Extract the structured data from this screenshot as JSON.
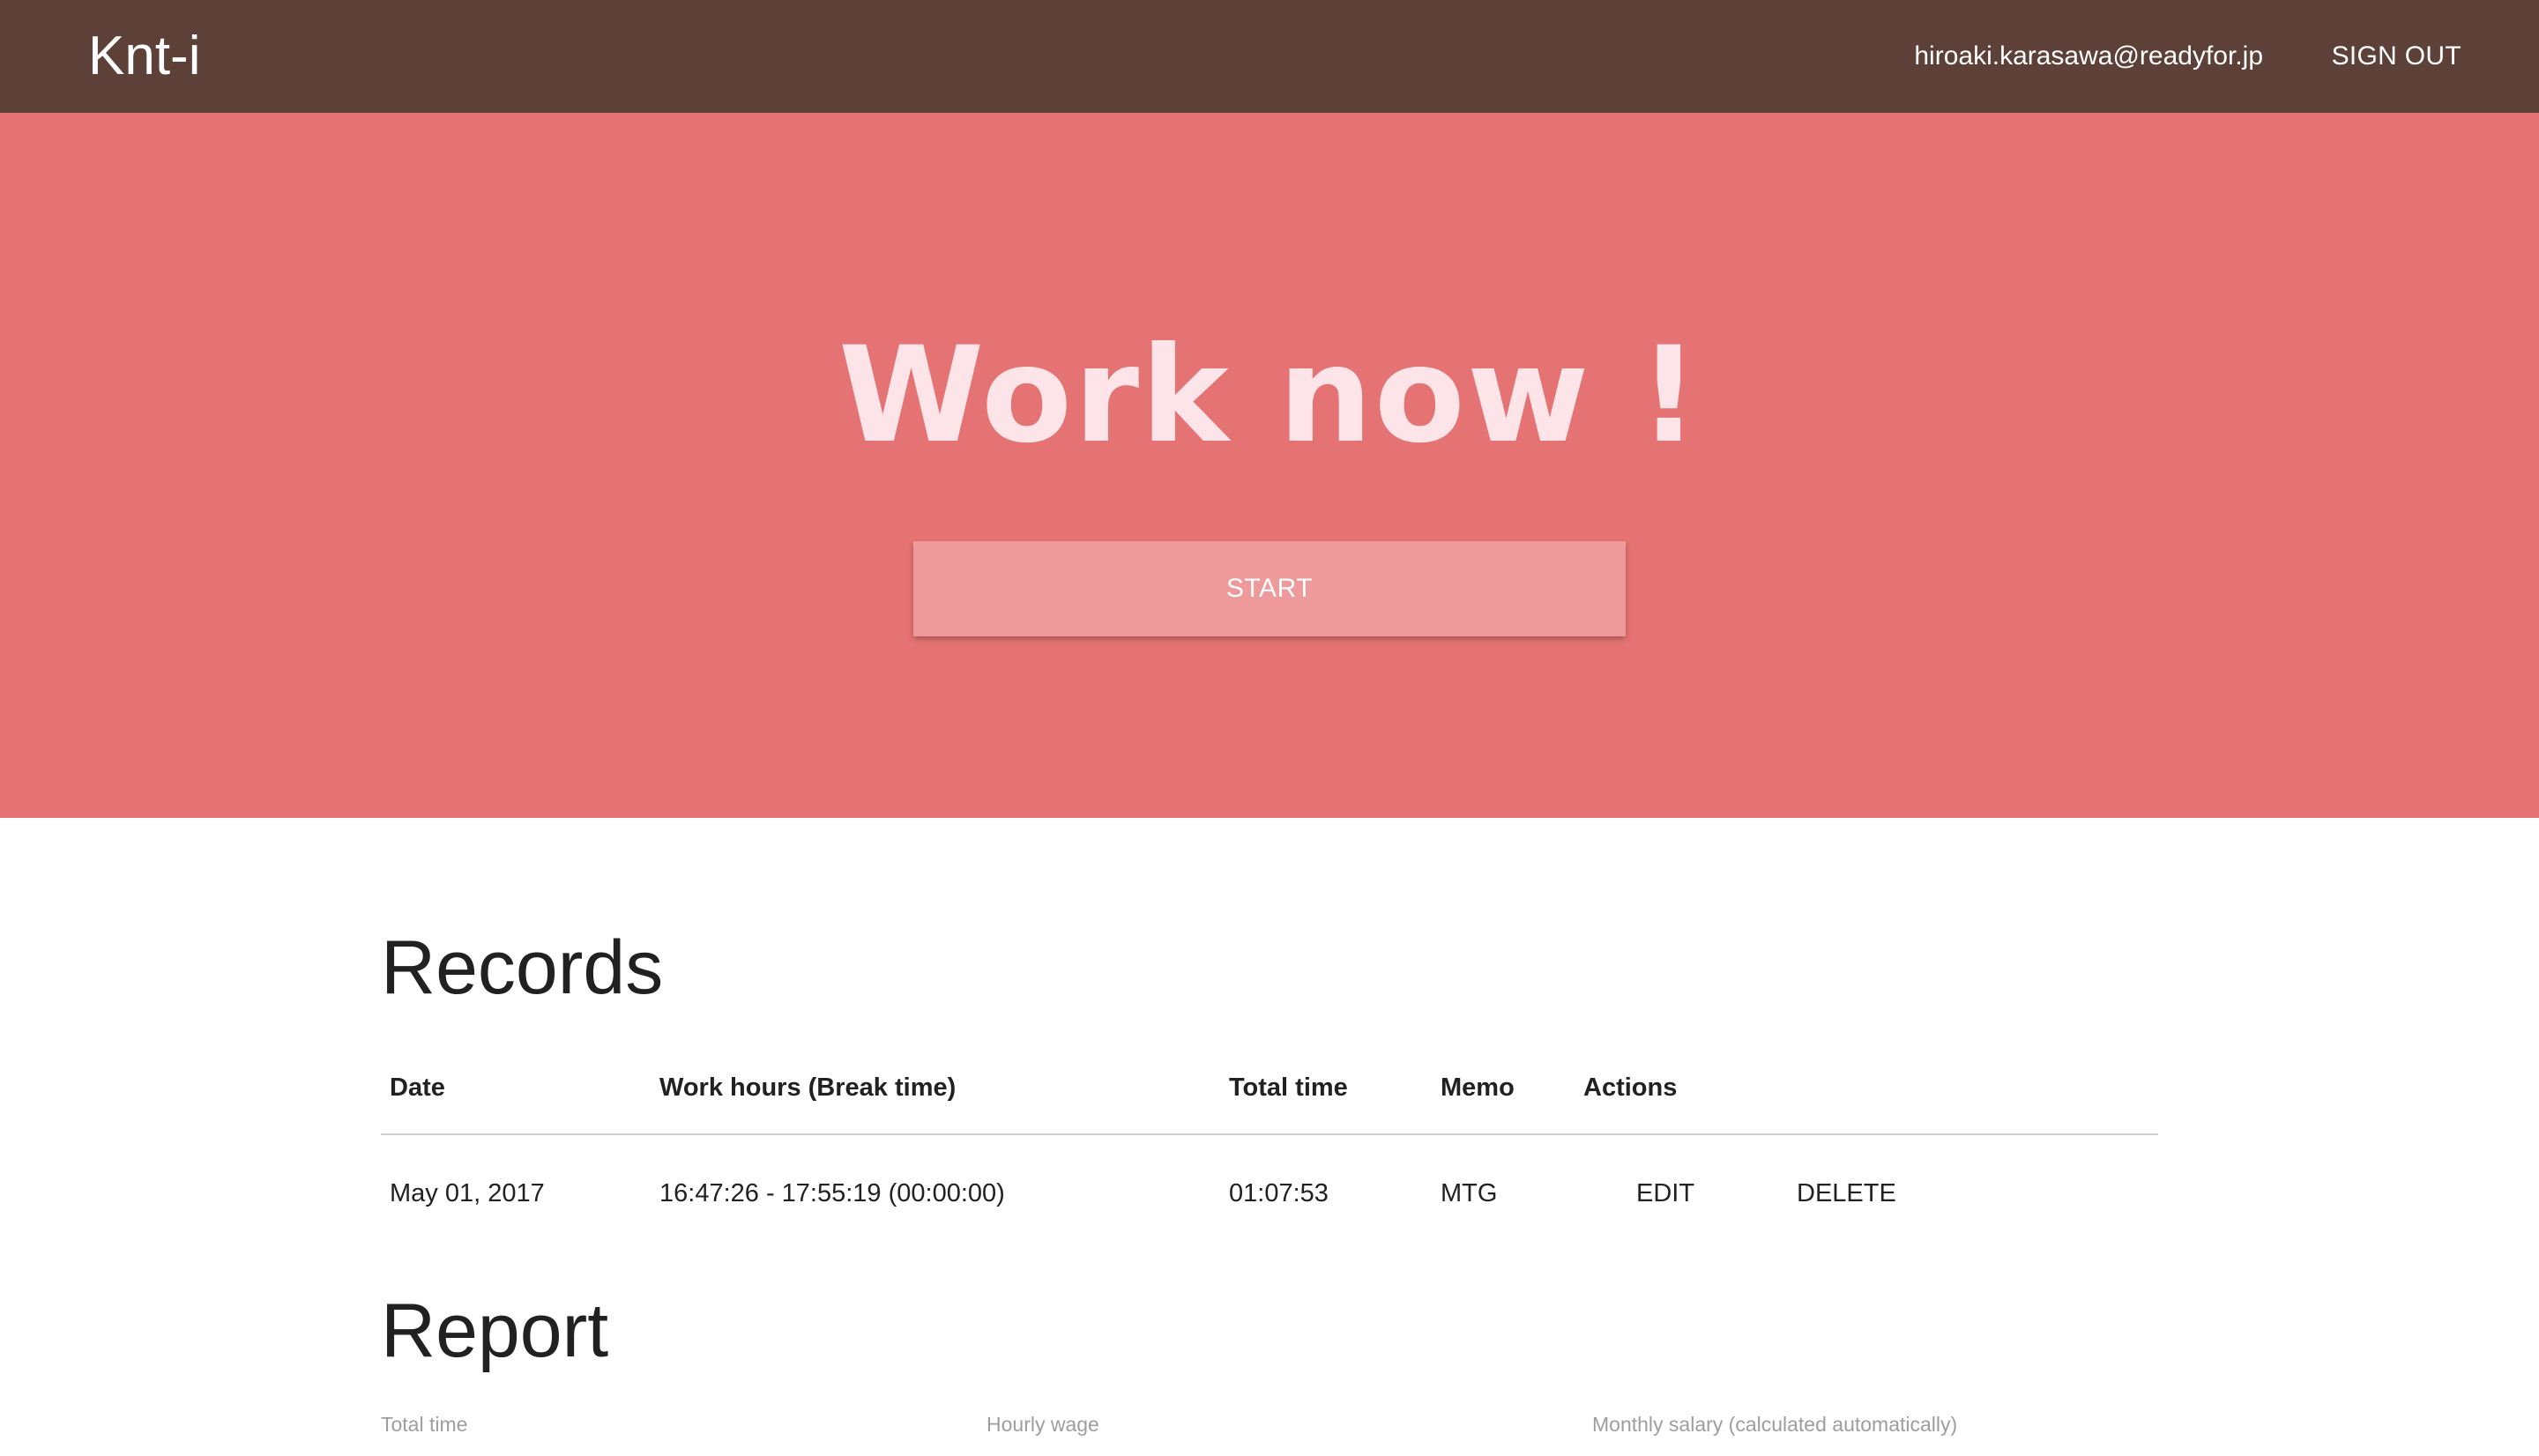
{
  "navbar": {
    "brand": "Knt-i",
    "email": "hiroaki.karasawa@readyfor.jp",
    "sign_out": "SIGN OUT"
  },
  "hero": {
    "title": "Work now !",
    "start_label": "START"
  },
  "records": {
    "title": "Records",
    "columns": [
      "Date",
      "Work hours (Break time)",
      "Total time",
      "Memo",
      "Actions"
    ],
    "rows": [
      {
        "date": "May 01, 2017",
        "work_hours": "16:47:26 - 17:55:19 (00:00:00)",
        "total_time": "01:07:53",
        "memo": "MTG",
        "edit_label": "EDIT",
        "delete_label": "DELETE"
      }
    ]
  },
  "report": {
    "title": "Report",
    "fields": [
      "Total time",
      "Hourly wage",
      "Monthly salary (calculated automatically)"
    ]
  },
  "colors": {
    "navbar": "#5d4037",
    "hero": "#e57373",
    "button": "#ef9a9a",
    "hero_text": "#fde4e8"
  }
}
